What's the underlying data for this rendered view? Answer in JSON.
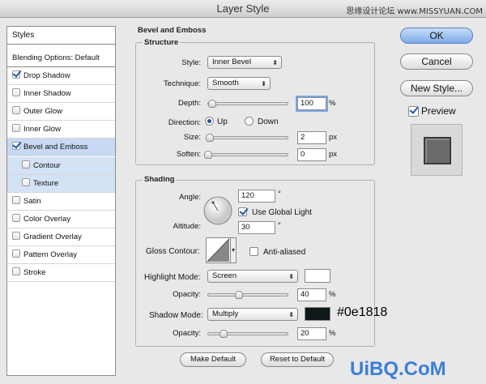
{
  "window": {
    "title": "Layer Style",
    "watermark_top": "思缘设计论坛 www.MISSYUAN.COM",
    "watermark_bottom": "UiBQ.CoM"
  },
  "styles_list": {
    "header": "Styles",
    "blending": "Blending Options: Default",
    "items": [
      {
        "label": "Drop Shadow",
        "checked": true
      },
      {
        "label": "Inner Shadow",
        "checked": false
      },
      {
        "label": "Outer Glow",
        "checked": false
      },
      {
        "label": "Inner Glow",
        "checked": false
      },
      {
        "label": "Bevel and Emboss",
        "checked": true,
        "selected": true
      },
      {
        "label": "Contour",
        "checked": false,
        "sub": true
      },
      {
        "label": "Texture",
        "checked": false,
        "sub": true
      },
      {
        "label": "Satin",
        "checked": false
      },
      {
        "label": "Color Overlay",
        "checked": false
      },
      {
        "label": "Gradient Overlay",
        "checked": false
      },
      {
        "label": "Pattern Overlay",
        "checked": false
      },
      {
        "label": "Stroke",
        "checked": false
      }
    ]
  },
  "bevel": {
    "title": "Bevel and Emboss",
    "structure": {
      "title": "Structure",
      "style_label": "Style:",
      "style_value": "Inner Bevel",
      "technique_label": "Technique:",
      "technique_value": "Smooth",
      "depth_label": "Depth:",
      "depth_value": "100",
      "depth_unit": "%",
      "depth_level": 0.05,
      "direction_label": "Direction:",
      "dir_up": "Up",
      "dir_down": "Down",
      "direction_value": "Up",
      "size_label": "Size:",
      "size_value": "2",
      "size_unit": "px",
      "size_level": 0.02,
      "soften_label": "Soften:",
      "soften_value": "0",
      "soften_unit": "px",
      "soften_level": 0.0
    },
    "shading": {
      "title": "Shading",
      "angle_label": "Angle:",
      "angle_value": "120",
      "angle_unit": "°",
      "global_light_label": "Use Global Light",
      "global_light": true,
      "altitude_label": "Altitude:",
      "altitude_value": "30",
      "altitude_unit": "°",
      "gloss_label": "Gloss Contour:",
      "anti_aliased_label": "Anti-aliased",
      "anti_aliased": false,
      "highlight_mode_label": "Highlight Mode:",
      "highlight_mode_value": "Screen",
      "highlight_color": "#ffffff",
      "hl_opacity_label": "Opacity:",
      "hl_opacity_value": "40",
      "hl_opacity_unit": "%",
      "hl_opacity_level": 0.4,
      "shadow_mode_label": "Shadow Mode:",
      "shadow_mode_value": "Multiply",
      "shadow_color": "#0e1818",
      "shadow_color_label": "#0e1818",
      "sh_opacity_label": "Opacity:",
      "sh_opacity_value": "20",
      "sh_opacity_unit": "%",
      "sh_opacity_level": 0.2
    },
    "make_default": "Make Default",
    "reset_default": "Reset to Default"
  },
  "actions": {
    "ok": "OK",
    "cancel": "Cancel",
    "new_style": "New Style...",
    "preview_label": "Preview",
    "preview": true
  }
}
